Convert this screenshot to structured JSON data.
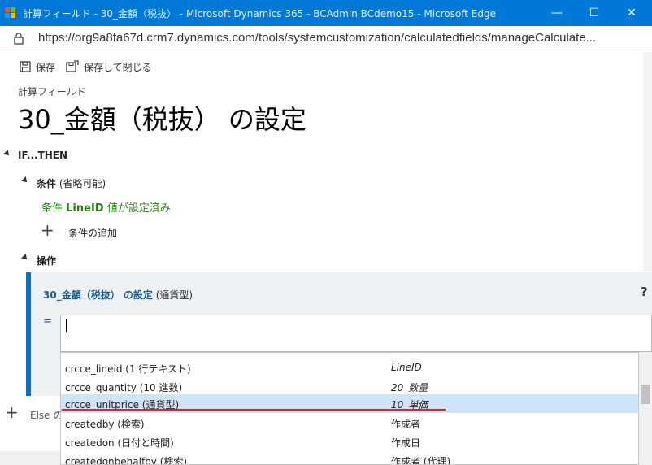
{
  "window": {
    "title": "計算フィールド - 30_金額（税抜） - Microsoft Dynamics 365 - BCAdmin BCdemo15 - Microsoft Edge",
    "minimize": "—",
    "maximize": "☐",
    "close": "✕"
  },
  "address": {
    "url": "https://org9a8fa67d.crm7.dynamics.com/tools/systemcustomization/calculatedfields/manageCalculate..."
  },
  "toolbar": {
    "save_label": "保存",
    "save_close_label": "保存して閉じる"
  },
  "header": {
    "subtitle": "計算フィールド",
    "title": "30_金額（税抜） の設定"
  },
  "sections": {
    "if_then": "IF...THEN",
    "condition_label": "条件",
    "condition_hint": "(省略可能)",
    "condition_value_prefix": "条件 ",
    "condition_field": "LineID",
    "condition_value_suffix": " 値が設定済み",
    "add_condition": "条件の追加",
    "action_label": "操作",
    "else_label": "Else の"
  },
  "action": {
    "field_title": "30_金額（税抜） の設定",
    "field_type": "(通貨型)",
    "equals": "=",
    "help": "?"
  },
  "dropdown": {
    "items": [
      {
        "name": "crcce_lineid (1 行テキスト)",
        "display": "LineID",
        "italic": true,
        "selected": false
      },
      {
        "name": "crcce_quantity (10 進数)",
        "display": "20_数量",
        "italic": true,
        "selected": false
      },
      {
        "name": "crcce_unitprice (通貨型)",
        "display": "10_単価",
        "italic": true,
        "selected": true
      },
      {
        "name": "createdby (検索)",
        "display": "作成者",
        "italic": false,
        "selected": false
      },
      {
        "name": "createdon (日付と時間)",
        "display": "作成日",
        "italic": false,
        "selected": false
      },
      {
        "name": "createdonbehalfby (検索)",
        "display": "作成者 (代理)",
        "italic": false,
        "selected": false
      }
    ]
  },
  "colors": {
    "titlebar": "#0078d7",
    "accent": "#106ebe",
    "condition_green": "#2e7d1a",
    "selected_row": "#cfe4f7",
    "annotation_red": "#d9262b"
  }
}
